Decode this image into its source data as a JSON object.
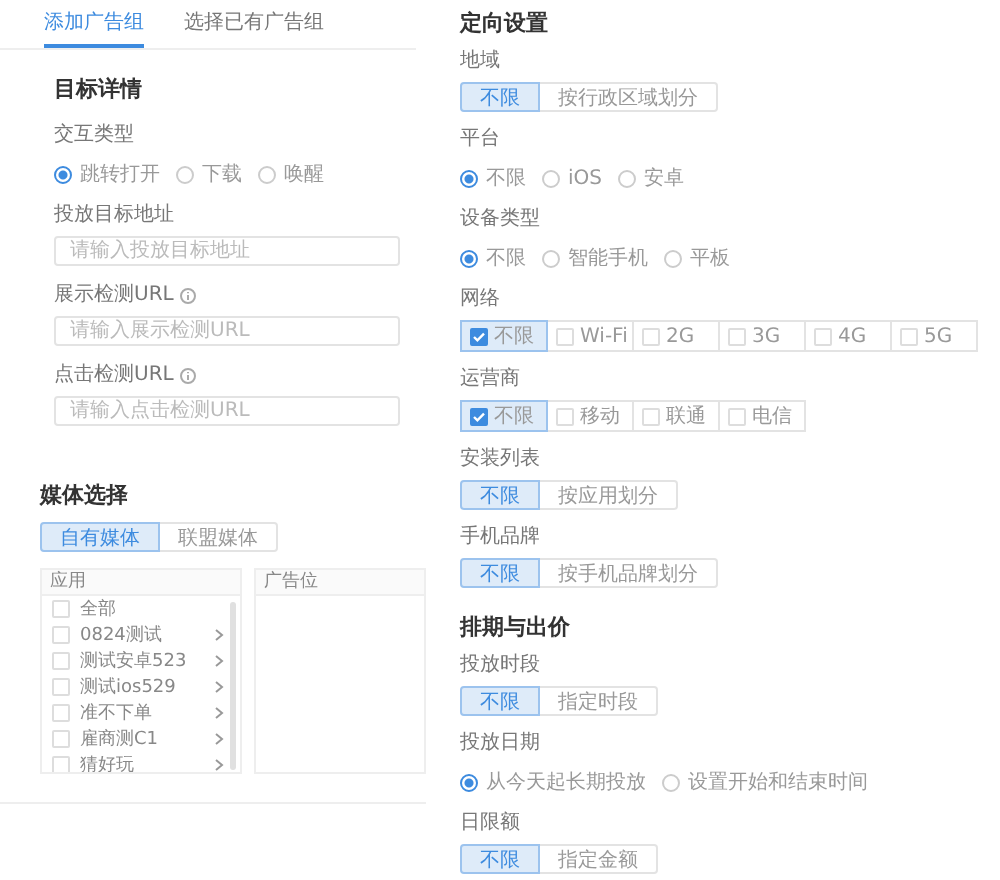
{
  "tabs": [
    {
      "label": "添加广告组",
      "selected": true
    },
    {
      "label": "选择已有广告组",
      "selected": false
    }
  ],
  "target_details": {
    "title": "目标详情",
    "fields": [
      {
        "kind": "radio",
        "label": "交互类型",
        "options": [
          {
            "label": "跳转打开",
            "selected": true
          },
          {
            "label": "下载",
            "selected": false
          },
          {
            "label": "唤醒",
            "selected": false
          }
        ]
      },
      {
        "kind": "input",
        "label": "投放目标地址",
        "info": false,
        "placeholder": "请输入投放目标地址"
      },
      {
        "kind": "input",
        "label": "展示检测URL",
        "info": true,
        "placeholder": "请输入展示检测URL"
      },
      {
        "kind": "input",
        "label": "点击检测URL",
        "info": true,
        "placeholder": "请输入点击检测URL"
      }
    ]
  },
  "media": {
    "title": "媒体选择",
    "segments": [
      {
        "label": "自有媒体",
        "selected": true
      },
      {
        "label": "联盟媒体",
        "selected": false
      }
    ],
    "app_panel": {
      "header": "应用",
      "items": [
        {
          "label": "全部",
          "checked": false,
          "expandable": false
        },
        {
          "label": "0824测试",
          "checked": false,
          "expandable": true
        },
        {
          "label": "测试安卓523",
          "checked": false,
          "expandable": true
        },
        {
          "label": "测试ios529",
          "checked": false,
          "expandable": true
        },
        {
          "label": "准不下单",
          "checked": false,
          "expandable": true
        },
        {
          "label": "雇商测C1",
          "checked": false,
          "expandable": true
        },
        {
          "label": "猜好玩",
          "checked": false,
          "expandable": true
        }
      ]
    },
    "slot_panel": {
      "header": "广告位"
    }
  },
  "targeting": {
    "title": "定向设置",
    "fields": [
      {
        "kind": "segmented",
        "label": "地域",
        "options": [
          {
            "label": "不限",
            "selected": true
          },
          {
            "label": "按行政区域划分",
            "selected": false
          }
        ]
      },
      {
        "kind": "radio",
        "label": "平台",
        "options": [
          {
            "label": "不限",
            "selected": true
          },
          {
            "label": "iOS",
            "selected": false
          },
          {
            "label": "安卓",
            "selected": false
          }
        ]
      },
      {
        "kind": "radio",
        "label": "设备类型",
        "options": [
          {
            "label": "不限",
            "selected": true
          },
          {
            "label": "智能手机",
            "selected": false
          },
          {
            "label": "平板",
            "selected": false
          }
        ]
      },
      {
        "kind": "checks",
        "label": "网络",
        "options": [
          {
            "label": "不限",
            "checked": true
          },
          {
            "label": "Wi-Fi",
            "checked": false
          },
          {
            "label": "2G",
            "checked": false
          },
          {
            "label": "3G",
            "checked": false
          },
          {
            "label": "4G",
            "checked": false
          },
          {
            "label": "5G",
            "checked": false
          }
        ]
      },
      {
        "kind": "checks",
        "label": "运营商",
        "options": [
          {
            "label": "不限",
            "checked": true
          },
          {
            "label": "移动",
            "checked": false
          },
          {
            "label": "联通",
            "checked": false
          },
          {
            "label": "电信",
            "checked": false
          }
        ]
      },
      {
        "kind": "segmented",
        "label": "安装列表",
        "options": [
          {
            "label": "不限",
            "selected": true
          },
          {
            "label": "按应用划分",
            "selected": false
          }
        ]
      },
      {
        "kind": "segmented",
        "label": "手机品牌",
        "options": [
          {
            "label": "不限",
            "selected": true
          },
          {
            "label": "按手机品牌划分",
            "selected": false
          }
        ]
      }
    ]
  },
  "schedule": {
    "title": "排期与出价",
    "fields": [
      {
        "kind": "segmented",
        "label": "投放时段",
        "options": [
          {
            "label": "不限",
            "selected": true
          },
          {
            "label": "指定时段",
            "selected": false
          }
        ]
      },
      {
        "kind": "radio",
        "label": "投放日期",
        "options": [
          {
            "label": "从今天起长期投放",
            "selected": true
          },
          {
            "label": "设置开始和结束时间",
            "selected": false
          }
        ]
      },
      {
        "kind": "segmented",
        "label": "日限额",
        "options": [
          {
            "label": "不限",
            "selected": true
          },
          {
            "label": "指定金额",
            "selected": false
          }
        ]
      }
    ]
  }
}
